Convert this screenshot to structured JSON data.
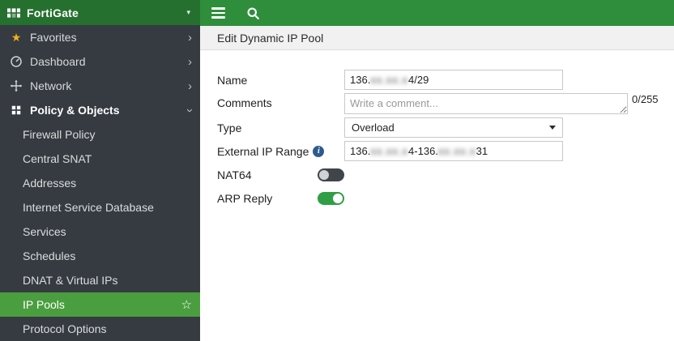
{
  "sidebar": {
    "brand": "FortiGate",
    "items": [
      {
        "label": "Favorites",
        "icon": "star"
      },
      {
        "label": "Dashboard",
        "icon": "gauge"
      },
      {
        "label": "Network",
        "icon": "arrows"
      },
      {
        "label": "Policy & Objects",
        "icon": "grid",
        "expanded": true
      }
    ],
    "policy_subitems": [
      "Firewall Policy",
      "Central SNAT",
      "Addresses",
      "Internet Service Database",
      "Services",
      "Schedules",
      "DNAT & Virtual IPs",
      "IP Pools",
      "Protocol Options"
    ],
    "selected_item": "IP Pools"
  },
  "toolbar": {
    "icons": [
      "menu",
      "search"
    ]
  },
  "page": {
    "title": "Edit Dynamic IP Pool"
  },
  "form": {
    "name": {
      "label": "Name",
      "value_prefix": "136.",
      "value_redacted": "xx.xx.x",
      "value_suffix": "4/29"
    },
    "comments": {
      "label": "Comments",
      "placeholder": "Write a comment...",
      "value": "",
      "counter": "0/255"
    },
    "type": {
      "label": "Type",
      "value": "Overload"
    },
    "external_ip_range": {
      "label": "External IP Range",
      "value_prefix": "136.",
      "value_redacted_1": "xx.xx.x",
      "value_middle": "4-136.",
      "value_redacted_2": "xx.xx.x",
      "value_suffix": "31"
    },
    "nat64": {
      "label": "NAT64",
      "state": "off"
    },
    "arp_reply": {
      "label": "ARP Reply",
      "state": "on"
    }
  },
  "colors": {
    "toolbar_green": "#2f8e3c",
    "brand_green": "#26702f",
    "sidebar_bg": "#363b41",
    "selected_green": "#4a9e3f",
    "toggle_on_green": "#2f9e44"
  }
}
